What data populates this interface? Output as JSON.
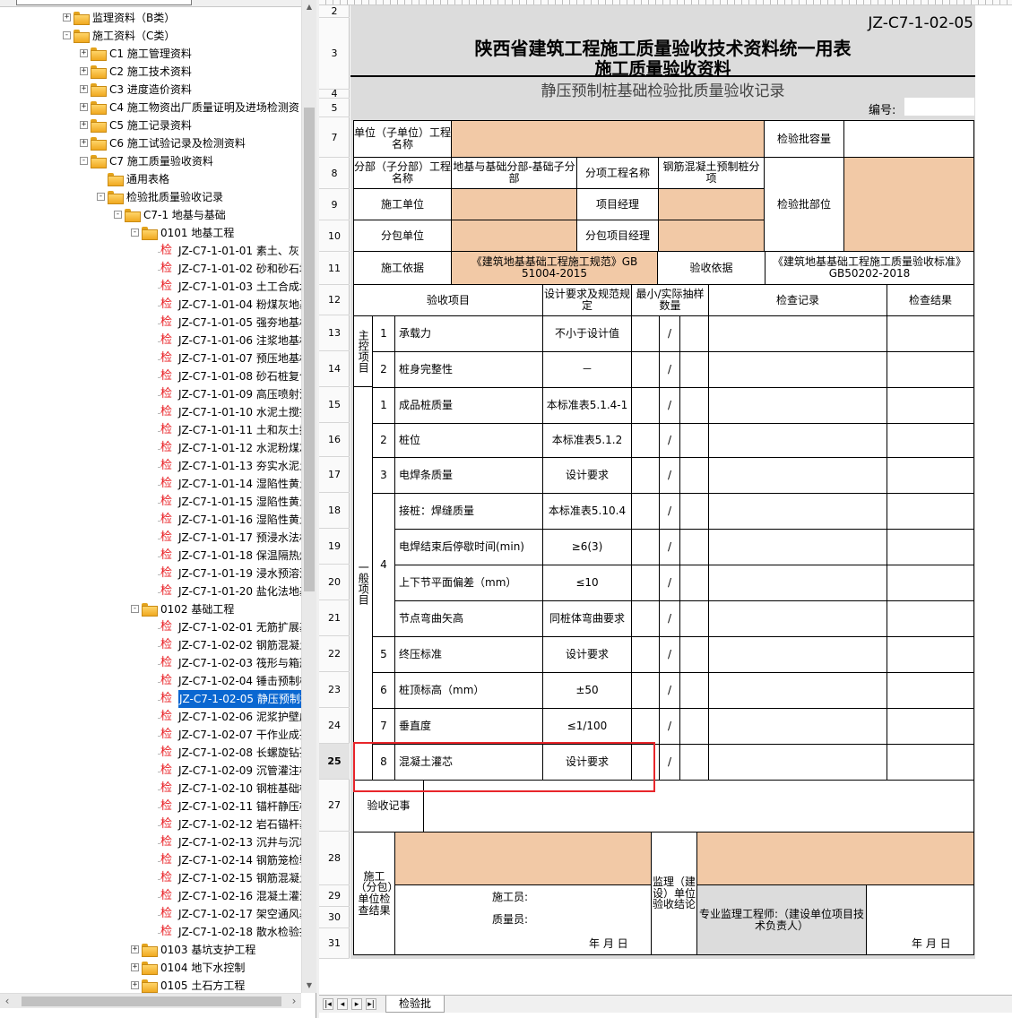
{
  "tree": {
    "rows": [
      {
        "depth": 0,
        "type": "folder",
        "exp": "+",
        "label": "监理资料（B类）"
      },
      {
        "depth": 0,
        "type": "folder",
        "exp": "-",
        "label": "施工资料（C类）"
      },
      {
        "depth": 1,
        "type": "folder",
        "exp": "+",
        "label": "C1  施工管理资料"
      },
      {
        "depth": 1,
        "type": "folder",
        "exp": "+",
        "label": "C2  施工技术资料"
      },
      {
        "depth": 1,
        "type": "folder",
        "exp": "+",
        "label": "C3  进度造价资料"
      },
      {
        "depth": 1,
        "type": "folder",
        "exp": "+",
        "label": "C4  施工物资出厂质量证明及进场检测资"
      },
      {
        "depth": 1,
        "type": "folder",
        "exp": "+",
        "label": "C5  施工记录资料"
      },
      {
        "depth": 1,
        "type": "folder",
        "exp": "+",
        "label": "C6  施工试验记录及检测资料"
      },
      {
        "depth": 1,
        "type": "folder",
        "exp": "-",
        "label": "C7  施工质量验收资料"
      },
      {
        "depth": 2,
        "type": "folder",
        "exp": "",
        "label": "通用表格"
      },
      {
        "depth": 2,
        "type": "folder",
        "exp": "-",
        "label": "检验批质量验收记录"
      },
      {
        "depth": 3,
        "type": "folder",
        "exp": "-",
        "label": "C7-1  地基与基础"
      },
      {
        "depth": 4,
        "type": "folder",
        "exp": "-",
        "label": "0101  地基工程"
      },
      {
        "depth": 5,
        "type": "doc",
        "label": "JZ-C7-1-01-01  素土、灰："
      },
      {
        "depth": 5,
        "type": "doc",
        "label": "JZ-C7-1-01-02  砂和砂石地"
      },
      {
        "depth": 5,
        "type": "doc",
        "label": "JZ-C7-1-01-03  土工合成木"
      },
      {
        "depth": 5,
        "type": "doc",
        "label": "JZ-C7-1-01-04  粉煤灰地基"
      },
      {
        "depth": 5,
        "type": "doc",
        "label": "JZ-C7-1-01-05  强夯地基札"
      },
      {
        "depth": 5,
        "type": "doc",
        "label": "JZ-C7-1-01-06  注浆地基札"
      },
      {
        "depth": 5,
        "type": "doc",
        "label": "JZ-C7-1-01-07  预压地基札"
      },
      {
        "depth": 5,
        "type": "doc",
        "label": "JZ-C7-1-01-08  砂石桩复合"
      },
      {
        "depth": 5,
        "type": "doc",
        "label": "JZ-C7-1-01-09  高压喷射注"
      },
      {
        "depth": 5,
        "type": "doc",
        "label": "JZ-C7-1-01-10  水泥土搅拌"
      },
      {
        "depth": 5,
        "type": "doc",
        "label": "JZ-C7-1-01-11  土和灰土挤"
      },
      {
        "depth": 5,
        "type": "doc",
        "label": "JZ-C7-1-01-12  水泥粉煤灰"
      },
      {
        "depth": 5,
        "type": "doc",
        "label": "JZ-C7-1-01-13  夯实水泥土"
      },
      {
        "depth": 5,
        "type": "doc",
        "label": "JZ-C7-1-01-14  湿陷性黄土"
      },
      {
        "depth": 5,
        "type": "doc",
        "label": "JZ-C7-1-01-15  湿陷性黄土"
      },
      {
        "depth": 5,
        "type": "doc",
        "label": "JZ-C7-1-01-16  湿陷性黄土"
      },
      {
        "depth": 5,
        "type": "doc",
        "label": "JZ-C7-1-01-17  预浸水法札"
      },
      {
        "depth": 5,
        "type": "doc",
        "label": "JZ-C7-1-01-18  保温隔热炉"
      },
      {
        "depth": 5,
        "type": "doc",
        "label": "JZ-C7-1-01-19  浸水预溶法"
      },
      {
        "depth": 5,
        "type": "doc",
        "label": "JZ-C7-1-01-20  盐化法地基"
      },
      {
        "depth": 4,
        "type": "folder",
        "exp": "-",
        "label": "0102  基础工程"
      },
      {
        "depth": 5,
        "type": "doc",
        "label": "JZ-C7-1-02-01  无筋扩展基"
      },
      {
        "depth": 5,
        "type": "doc",
        "label": "JZ-C7-1-02-02  钢筋混凝土"
      },
      {
        "depth": 5,
        "type": "doc",
        "label": "JZ-C7-1-02-03  筏形与箱形"
      },
      {
        "depth": 5,
        "type": "doc",
        "label": "JZ-C7-1-02-04  锤击预制桩"
      },
      {
        "depth": 5,
        "type": "doc",
        "label": "JZ-C7-1-02-05  静压预制桩",
        "selected": true
      },
      {
        "depth": 5,
        "type": "doc",
        "label": "JZ-C7-1-02-06  泥浆护壁成"
      },
      {
        "depth": 5,
        "type": "doc",
        "label": "JZ-C7-1-02-07  干作业成孔"
      },
      {
        "depth": 5,
        "type": "doc",
        "label": "JZ-C7-1-02-08  长螺旋钻孔"
      },
      {
        "depth": 5,
        "type": "doc",
        "label": "JZ-C7-1-02-09  沉管灌注桩"
      },
      {
        "depth": 5,
        "type": "doc",
        "label": "JZ-C7-1-02-10  钢桩基础检"
      },
      {
        "depth": 5,
        "type": "doc",
        "label": "JZ-C7-1-02-11  锚杆静压桩"
      },
      {
        "depth": 5,
        "type": "doc",
        "label": "JZ-C7-1-02-12  岩石锚杆基"
      },
      {
        "depth": 5,
        "type": "doc",
        "label": "JZ-C7-1-02-13  沉井与沉箱"
      },
      {
        "depth": 5,
        "type": "doc",
        "label": "JZ-C7-1-02-14  钢筋笼检验"
      },
      {
        "depth": 5,
        "type": "doc",
        "label": "JZ-C7-1-02-15  钢筋混凝土"
      },
      {
        "depth": 5,
        "type": "doc",
        "label": "JZ-C7-1-02-16  混凝土灌注"
      },
      {
        "depth": 5,
        "type": "doc",
        "label": "JZ-C7-1-02-17  架空通风基"
      },
      {
        "depth": 5,
        "type": "doc",
        "label": "JZ-C7-1-02-18  散水检验批"
      },
      {
        "depth": 4,
        "type": "folder",
        "exp": "+",
        "label": "0103  基坑支护工程"
      },
      {
        "depth": 4,
        "type": "folder",
        "exp": "+",
        "label": "0104  地下水控制"
      },
      {
        "depth": 4,
        "type": "folder",
        "exp": "+",
        "label": "0105  土石方工程"
      }
    ],
    "doc_glyph": "检"
  },
  "sheet": {
    "row_numbers": [
      "2",
      "3",
      "4",
      "5",
      "7",
      "8",
      "9",
      "10",
      "11",
      "12",
      "13",
      "14",
      "15",
      "16",
      "17",
      "18",
      "19",
      "20",
      "21",
      "22",
      "23",
      "24",
      "25",
      "27",
      "28",
      "29",
      "30",
      "31"
    ],
    "active_row": "25",
    "code": "JZ-C7-1-02-05",
    "title1": "陕西省建筑工程施工质量验收技术资料统一用表",
    "title2": "施工质量验收资料",
    "subtitle": "静压预制桩基础检验批质量验收记录",
    "number_label": "编号:",
    "cells": {
      "unit_name": "单位（子单位）工程名称",
      "batch_capacity": "检验批容量",
      "subdiv_name": "分部（子分部）工程名称",
      "subdiv_value": "地基与基础分部-基础子分部",
      "subitem_name": "分项工程名称",
      "subitem_value": "钢筋混凝土预制桩分项",
      "batch_location": "检验批部位",
      "contractor": "施工单位",
      "project_manager": "项目经理",
      "subcontractor": "分包单位",
      "sub_project_manager": "分包项目经理",
      "construction_basis": "施工依据",
      "construction_basis_value": "《建筑地基基础工程施工规范》GB 51004-2015",
      "acceptance_basis": "验收依据",
      "acceptance_basis_value": "《建筑地基基础工程施工质量验收标准》GB50202-2018",
      "col_item": "验收项目",
      "col_design": "设计要求及规范规定",
      "col_sample": "最小/实际抽样数量",
      "col_record": "检查记录",
      "col_result": "检查结果",
      "main_items": "主控项目",
      "general_items": "一般项目",
      "remarks": "验收记事",
      "contractor_result": "施工（分包）单位检查结果",
      "constructor_sign": "施工员:",
      "quality_sign": "质量员:",
      "supervisor_result": "监理（建设）单位验收结论",
      "supervisor_engineer": "专业监理工程师:（建设单位项目技术负责人）",
      "date1": "年  月  日",
      "date2": "年  月  日"
    },
    "items": [
      {
        "no": "1",
        "name": "承载力",
        "req": "不小于设计值",
        "slash": "/"
      },
      {
        "no": "2",
        "name": "桩身完整性",
        "req": "－",
        "slash": "/"
      },
      {
        "no": "1",
        "name": "成品桩质量",
        "req": "本标准表5.1.4-1",
        "slash": "/"
      },
      {
        "no": "2",
        "name": "桩位",
        "req": "本标准表5.1.2",
        "slash": "/"
      },
      {
        "no": "3",
        "name": "电焊条质量",
        "req": "设计要求",
        "slash": "/"
      },
      {
        "no": "",
        "name": "接桩：焊缝质量",
        "req": "本标准表5.10.4",
        "slash": "/"
      },
      {
        "no": "",
        "name": "电焊结束后停歇时间(min)",
        "req": "≥6(3)",
        "slash": "/"
      },
      {
        "no": "",
        "name": "上下节平面偏差（mm）",
        "req": "≤10",
        "slash": "/"
      },
      {
        "no": "",
        "name": "节点弯曲矢高",
        "req": "同桩体弯曲要求",
        "slash": "/"
      },
      {
        "no": "5",
        "name": "终压标准",
        "req": "设计要求",
        "slash": "/"
      },
      {
        "no": "6",
        "name": "桩顶标高（mm）",
        "req": "±50",
        "slash": "/"
      },
      {
        "no": "7",
        "name": "垂直度",
        "req": "≤1/100",
        "slash": "/"
      },
      {
        "no": "8",
        "name": "混凝土灌芯",
        "req": "设计要求",
        "slash": "/"
      }
    ],
    "group4_no": "4"
  },
  "tabs": {
    "nav": [
      "|◂",
      "◂",
      "▸",
      "▸|"
    ],
    "active": "检验批"
  },
  "colors": {
    "peach": "#f2c9a6",
    "highlight": "#e8262b",
    "selection": "#0a67d1"
  }
}
